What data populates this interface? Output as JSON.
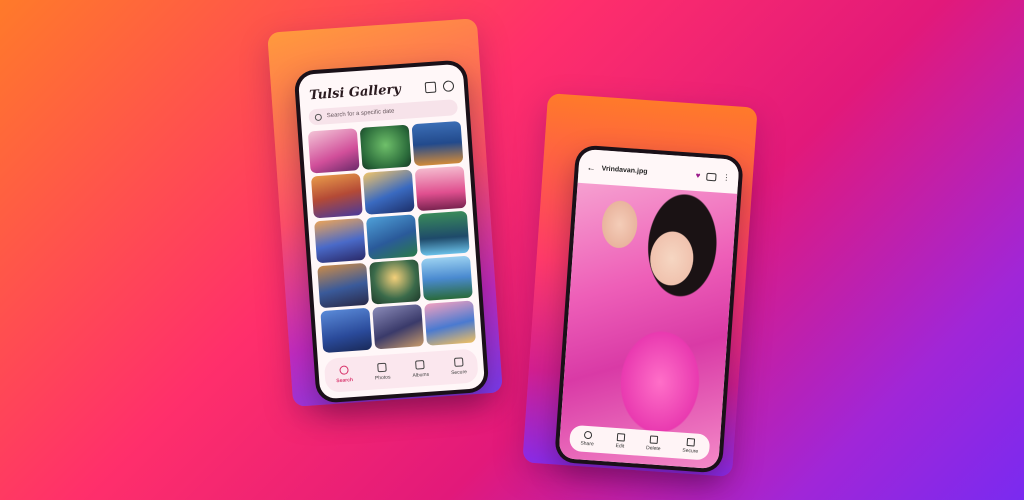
{
  "colors": {
    "accent": "#d8336b",
    "heart": "#9a1a8a"
  },
  "gallery": {
    "title": "Tulsi Gallery",
    "search_placeholder": "Search for a specific date",
    "nav": [
      {
        "label": "Search",
        "icon": "search-icon",
        "active": true
      },
      {
        "label": "Photos",
        "icon": "photos-icon",
        "active": false
      },
      {
        "label": "Albums",
        "icon": "albums-icon",
        "active": false
      },
      {
        "label": "Secure",
        "icon": "lock-icon",
        "active": false
      }
    ]
  },
  "viewer": {
    "file_name": "Vrindavan.jpg",
    "actions": [
      {
        "label": "Share",
        "icon": "share-icon"
      },
      {
        "label": "Edit",
        "icon": "edit-icon"
      },
      {
        "label": "Delete",
        "icon": "trash-icon"
      },
      {
        "label": "Secure",
        "icon": "lock-icon"
      }
    ]
  }
}
